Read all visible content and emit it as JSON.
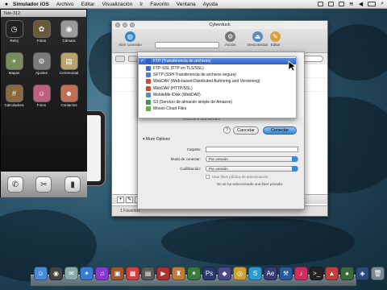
{
  "menubar": {
    "apple": "",
    "items": [
      "Simulador iOS",
      "Archivo",
      "Editar",
      "Visualización",
      "Ir",
      "Favorito",
      "Ventana",
      "Ayuda"
    ]
  },
  "simulator": {
    "title": "Tele-312",
    "apps": [
      {
        "label": "Reloj",
        "icon": "clock-icon",
        "color": "#222"
      },
      {
        "label": "Fotos",
        "icon": "photos-icon",
        "color": "#6b5a3a"
      },
      {
        "label": "Cámara",
        "icon": "camera-icon",
        "color": "#9a9a9a"
      },
      {
        "label": "Mapas",
        "icon": "map-icon",
        "color": "#7a8c5a"
      },
      {
        "label": "Ajustes",
        "icon": "settings-icon",
        "color": "#7a7a7a"
      },
      {
        "label": "Ceremonial",
        "icon": "calendar-icon",
        "color": "#b8a46a"
      },
      {
        "label": "Calculadora",
        "icon": "calculator-icon",
        "color": "#8a6a3a"
      },
      {
        "label": "Fotos",
        "icon": "cartoon-icon",
        "color": "#c06080"
      },
      {
        "label": "Contactos",
        "icon": "contacts-icon",
        "color": "#c07050"
      }
    ],
    "dock": [
      "phone-icon",
      "tools-icon",
      "ipod-icon"
    ]
  },
  "cyberduck": {
    "title": "Cyberduck",
    "toolbar": {
      "open_connection": "Abrir conexión",
      "quick_connect": "Conexión rápida",
      "action": "Acción",
      "disconnect": "Desconectar",
      "edit": "Editar"
    },
    "status": "1 Favoritos"
  },
  "connect_sheet": {
    "line_text": "Analizar a otra servidor",
    "help": "?",
    "cancel": "Cancelar",
    "connect": "Conectar",
    "more_options": "More Options",
    "fields": [
      {
        "label": "Carpeta:",
        "value": ""
      },
      {
        "label": "Modo de conectar:",
        "value": "Por omisión"
      },
      {
        "label": "Codificación:",
        "value": "Por omisión"
      }
    ],
    "checkbox": "Usar llave pública de autenticación",
    "key_text": "No se ha seleccionado una llave privada"
  },
  "protocol_dropdown": {
    "selected_index": 0,
    "options": [
      {
        "label": "FTP (Transferencia de archivos)",
        "color": "#2e5fc9"
      },
      {
        "label": "FTP-SSL (FTP en TLS/SSL)",
        "color": "#3a6fd0"
      },
      {
        "label": "SFTP (SSH Transferencia de archivos segura)",
        "color": "#4a7fd8"
      },
      {
        "label": "WebDAV (Web-based Distributed Authoring and Versioning)",
        "color": "#d04a3a"
      },
      {
        "label": "WebDAV (HTTP/SSL)",
        "color": "#d04a3a"
      },
      {
        "label": "MobileMe iDisk (WebDAV)",
        "color": "#5a8ad0"
      },
      {
        "label": "S3 (Servicio de almacén simple de Amazon)",
        "color": "#3a9a4a"
      },
      {
        "label": "Mosso Cloud Files",
        "color": "#6aa84a"
      }
    ]
  },
  "dock": {
    "items": [
      {
        "name": "finder-icon",
        "color": "#4a8ad8",
        "glyph": "☺"
      },
      {
        "name": "dashboard-icon",
        "color": "#444",
        "glyph": "◉"
      },
      {
        "name": "mail-icon",
        "color": "#8aa",
        "glyph": "✉"
      },
      {
        "name": "safari-icon",
        "color": "#3a7ad0",
        "glyph": "✦"
      },
      {
        "name": "itunes-icon",
        "color": "#8a3ad0",
        "glyph": "♫"
      },
      {
        "name": "photo-icon",
        "color": "#a05a2a",
        "glyph": "▣"
      },
      {
        "name": "ical-icon",
        "color": "#d04040",
        "glyph": "▦"
      },
      {
        "name": "preview-icon",
        "color": "#5a5a5a",
        "glyph": "▤"
      },
      {
        "name": "video-icon",
        "color": "#b03030",
        "glyph": "▶"
      },
      {
        "name": "game-icon",
        "color": "#c07a3a",
        "glyph": "♜"
      },
      {
        "name": "star-icon",
        "color": "#3a7a3a",
        "glyph": "✶"
      },
      {
        "name": "photoshop-icon",
        "color": "#2a3a6a",
        "glyph": "Ps"
      },
      {
        "name": "app-icon",
        "color": "#4a4a8a",
        "glyph": "◆"
      },
      {
        "name": "chrome-icon",
        "color": "#d0a030",
        "glyph": "◎"
      },
      {
        "name": "skype-icon",
        "color": "#2a9ad0",
        "glyph": "S"
      },
      {
        "name": "aftereffects-icon",
        "color": "#3a3a7a",
        "glyph": "Ae"
      },
      {
        "name": "xcode-icon",
        "color": "#2a5a9a",
        "glyph": "⚒"
      },
      {
        "name": "itunes2-icon",
        "color": "#d03060",
        "glyph": "♪"
      },
      {
        "name": "terminal-icon",
        "color": "#222",
        "glyph": ">_"
      },
      {
        "name": "app2-icon",
        "color": "#c04040",
        "glyph": "▲"
      },
      {
        "name": "app3-icon",
        "color": "#3a6a3a",
        "glyph": "●"
      },
      {
        "name": "app4-icon",
        "color": "#2a4a7a",
        "glyph": "◈"
      },
      {
        "name": "trash-icon",
        "color": "#7a8a9a",
        "glyph": "🗑"
      }
    ]
  }
}
